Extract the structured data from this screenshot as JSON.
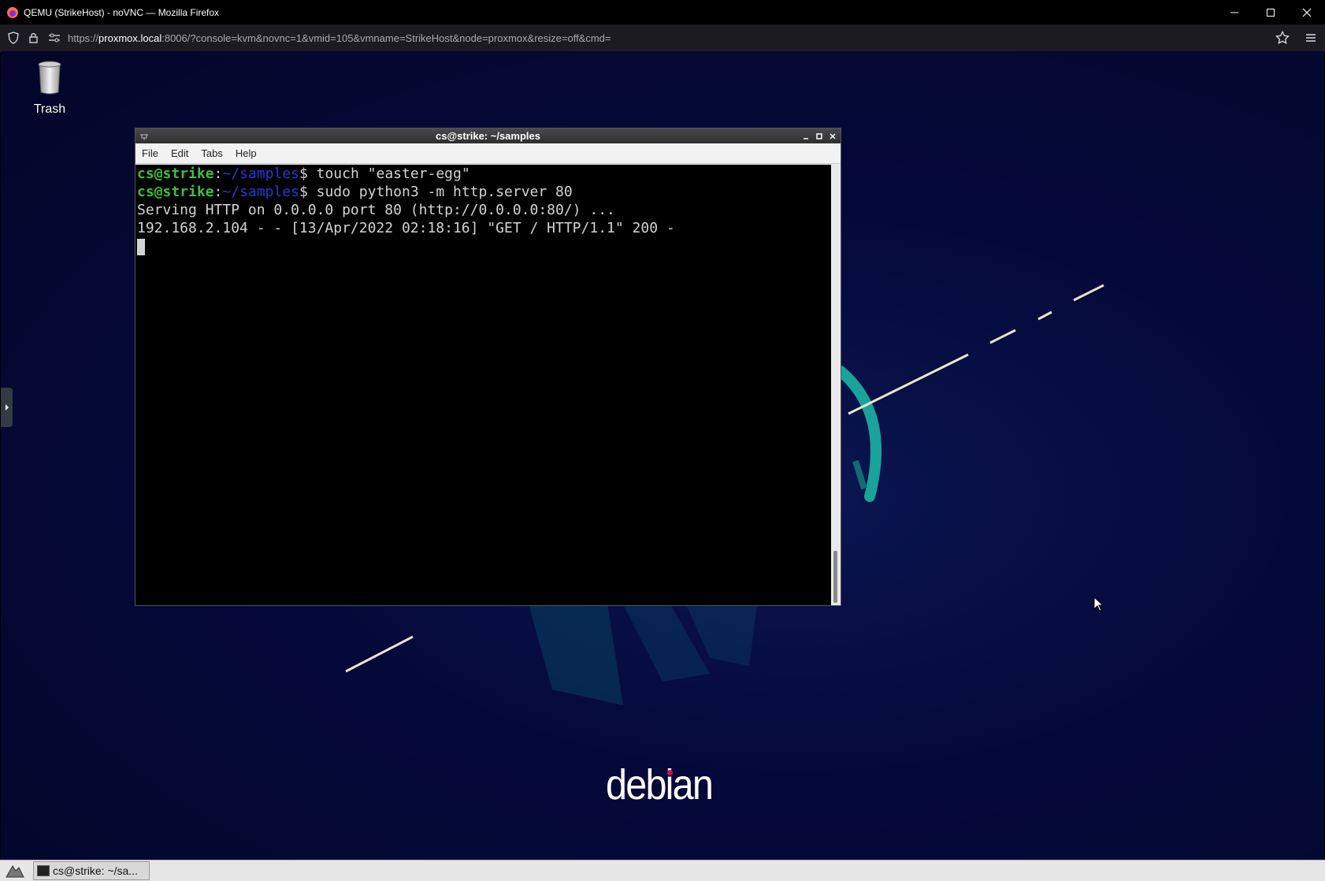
{
  "browser": {
    "window_title": "QEMU (StrikeHost) - noVNC — Mozilla Firefox",
    "url_prefix": "https://",
    "url_host": "proxmox.local",
    "url_rest": ":8006/?console=kvm&novnc=1&vmid=105&vmname=StrikeHost&node=proxmox&resize=off&cmd="
  },
  "desktop": {
    "trash_label": "Trash",
    "brand": "debian"
  },
  "terminal": {
    "title": "cs@strike: ~/samples",
    "menu": [
      "File",
      "Edit",
      "Tabs",
      "Help"
    ],
    "prompt_user": "cs@strike",
    "prompt_sep": ":",
    "prompt_path": "~/samples",
    "prompt_end": "$",
    "commands": [
      " touch \"easter-egg\"",
      " sudo python3 -m http.server 80"
    ],
    "output": [
      "Serving HTTP on 0.0.0.0 port 80 (http://0.0.0.0:80/) ...",
      "192.168.2.104 - - [13/Apr/2022 02:18:16] \"GET / HTTP/1.1\" 200 -"
    ]
  },
  "taskbar": {
    "task_label": "cs@strike: ~/sa..."
  }
}
